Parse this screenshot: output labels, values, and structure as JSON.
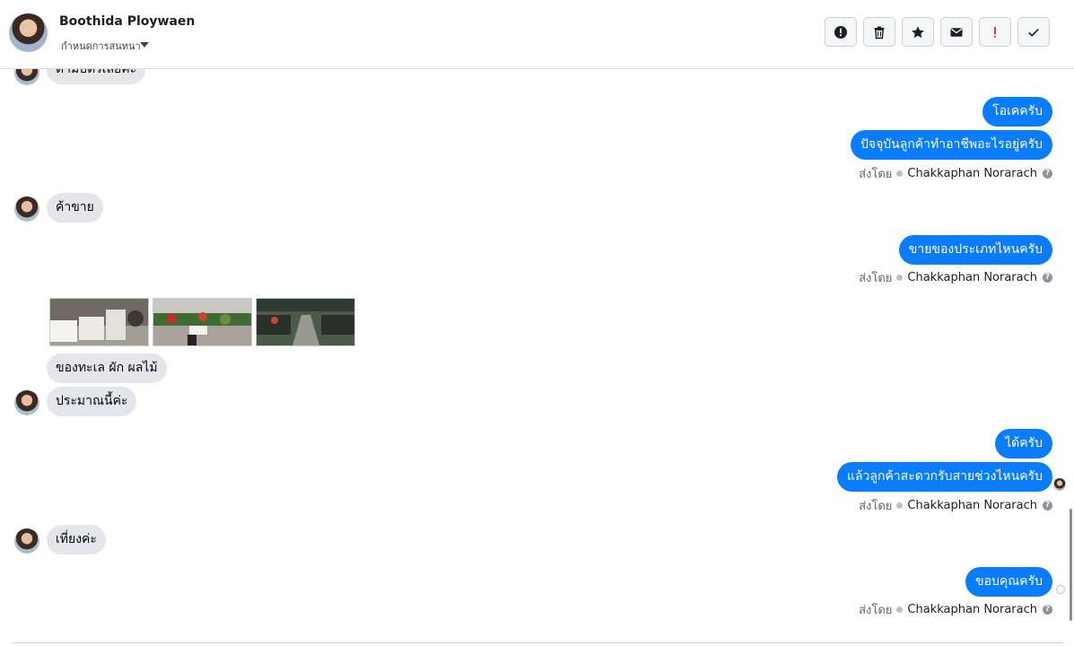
{
  "header": {
    "contact_name": "Boothida Ploywaen",
    "assign_label": "กำหนดการสนทนา",
    "toolbar": {
      "spam_icon": "alert-circle-icon",
      "delete_icon": "trash-icon",
      "star_icon": "star-icon",
      "unread_icon": "envelope-icon",
      "follow_up_icon": "exclamation-icon",
      "done_icon": "checkmark-icon"
    }
  },
  "colors": {
    "outgoing_bubble": "#0a7cff",
    "incoming_bubble": "#e4e6eb",
    "follow_up_red": "#e41e3f"
  },
  "messages": [
    {
      "direction": "in",
      "text": "ตามบัตรเลยค่ะ"
    },
    {
      "direction": "out",
      "text": "โอเคครับ"
    },
    {
      "direction": "out",
      "text": "ปัจจุบันลูกค้าทำอาชีพอะไรอยู่ครับ"
    },
    {
      "direction": "in",
      "text": "ค้าขาย"
    },
    {
      "direction": "out",
      "text": "ขายของประเภทไหนครับ"
    },
    {
      "direction": "in",
      "text": "ของทะเล ผัก ผลไม้"
    },
    {
      "direction": "in",
      "text": "ประมาณนี้ค่ะ"
    },
    {
      "direction": "out",
      "text": "ได้ครับ"
    },
    {
      "direction": "out",
      "text": "แล้วลูกค้าสะดวกรับสายช่วงไหนครับ"
    },
    {
      "direction": "in",
      "text": "เที่ยงค่ะ"
    },
    {
      "direction": "out",
      "text": "ขอบคุณครับ"
    }
  ],
  "sent_by": {
    "prefix": "ส่งโดย",
    "agent": "Chakkaphan Norarach",
    "help": "?"
  }
}
